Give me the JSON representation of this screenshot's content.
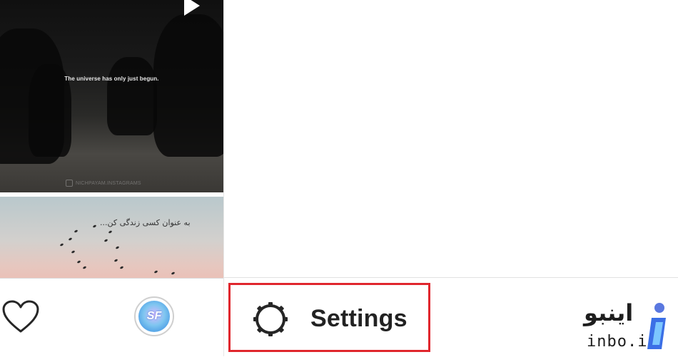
{
  "feed": {
    "video_post": {
      "caption": "The universe has only just begun.",
      "watermark": "NICHPAYAM.INSTAGRAMS"
    },
    "image_post": {
      "overlay_text": "به عنوان کسی زندگی کن..."
    }
  },
  "bottom_nav": {
    "icons": [
      "heart-icon",
      "profile-avatar"
    ],
    "avatar_text": "SF"
  },
  "menu": {
    "settings_label": "Settings",
    "settings_icon": "gear-icon",
    "highlight_color": "#e0262d"
  },
  "branding": {
    "name": "اینبو",
    "url": "inbo.ir",
    "accent": "#3b6fe6"
  }
}
